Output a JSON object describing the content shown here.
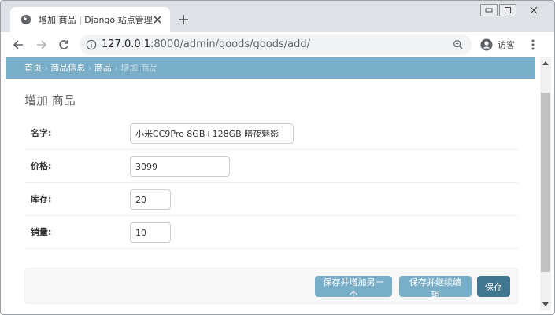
{
  "browser": {
    "tab": {
      "title": "增加 商品 | Django 站点管理员"
    },
    "address": {
      "host": "127.0.0.1",
      "path": ":8000/admin/goods/goods/add/"
    },
    "profile": {
      "label": "访客"
    }
  },
  "breadcrumbs": {
    "items": [
      "首页",
      "商品信息",
      "商品"
    ],
    "current": "增加 商品",
    "separator": "›"
  },
  "page": {
    "title": "增加 商品"
  },
  "form": {
    "fields": [
      {
        "label": "名字:",
        "value": "小米CC9Pro 8GB+128GB 暗夜魅影"
      },
      {
        "label": "价格:",
        "value": "3099"
      },
      {
        "label": "库存:",
        "value": "20"
      },
      {
        "label": "销量:",
        "value": "10"
      }
    ]
  },
  "actions": {
    "save_add_another": "保存并增加另一个",
    "save_continue": "保存并继续编辑",
    "save": "保存"
  },
  "colors": {
    "header": "#79aec8",
    "primary_button": "#417690",
    "secondary_button": "#79aec8"
  }
}
